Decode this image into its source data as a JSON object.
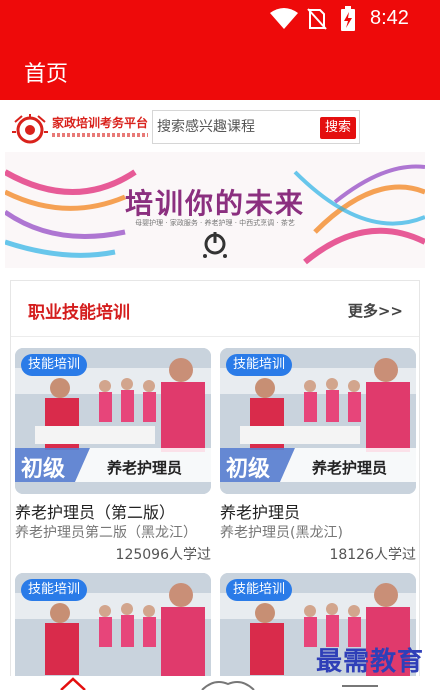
{
  "status_bar": {
    "time": "8:42"
  },
  "app_bar": {
    "title": "首页"
  },
  "header": {
    "logo_text": "家政培训考务平台",
    "search_placeholder": "搜索感兴趣课程",
    "search_button": "搜索"
  },
  "banner": {
    "title": "培训你的未来",
    "subtitle": "母婴护理 · 家政服务 · 养老护理 · 中西式烹调 · 茶艺"
  },
  "section": {
    "title": "职业技能培训",
    "more": "更多>>"
  },
  "courses": [
    {
      "tag": "技能培训",
      "level": "初级",
      "image_label": "养老护理员",
      "title": "养老护理员（第二版）",
      "desc": "养老护理员第二版（黑龙江）",
      "count": "125096人学过"
    },
    {
      "tag": "技能培训",
      "level": "初级",
      "image_label": "养老护理员",
      "title": "养老护理员",
      "desc": "养老护理员(黑龙江)",
      "count": "18126人学过"
    },
    {
      "tag": "技能培训"
    },
    {
      "tag": "技能培训"
    }
  ],
  "watermark": "最需教育",
  "colors": {
    "brand_red": "#ee0a0a",
    "tag_blue": "#2a7be8",
    "section_red": "#d41d1d"
  }
}
